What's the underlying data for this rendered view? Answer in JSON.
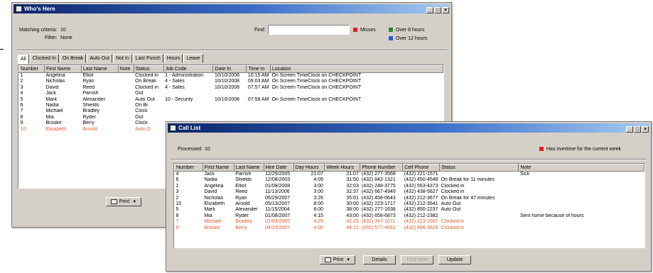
{
  "back_window": {
    "title": "Who's Here",
    "matching_label": "Matching criteria:",
    "matching_value": "10",
    "filter_label": "Filter:",
    "filter_value": "None",
    "find_label": "Find:",
    "find_value": "",
    "legend": [
      {
        "label": "Misses",
        "color": "#e0201e"
      },
      {
        "label": "Over 8 hours",
        "color": "#2a8a2a"
      },
      {
        "label": "Over 12 hours",
        "color": "#2d5bd0"
      }
    ],
    "tabs": [
      "All",
      "Clocked In",
      "On Break",
      "Auto Out",
      "Not In",
      "Last Punch",
      "Hours",
      "Leave"
    ],
    "columns": [
      "Number",
      "First Name",
      "Last Name",
      "Note",
      "Status",
      "Job Code",
      "Date In",
      "Time In",
      "Location"
    ],
    "rows": [
      [
        "1",
        "Angelina",
        "Elliot",
        "",
        "Clocked in",
        "1 - Administration",
        "10/10/2008",
        "10:15 AM",
        "On Screen TimeClock on CHECKPOINT",
        ""
      ],
      [
        "2",
        "Nicholas",
        "Ryan",
        "",
        "On Break",
        "4 - Sales",
        "10/10/2008",
        "09:03 AM",
        "On Screen TimeClock on CHECKPOINT",
        ""
      ],
      [
        "3",
        "David",
        "Reed",
        "",
        "Clocked in",
        "4 - Sales",
        "10/10/2008",
        "07:57 AM",
        "On Screen TimeClock on CHECKPOINT",
        ""
      ],
      [
        "4",
        "Jack",
        "Parrish",
        "",
        "Out",
        "",
        "",
        "",
        "",
        ""
      ],
      [
        "5",
        "Mark",
        "Alexander",
        "",
        "Auto Out",
        "10 - Security",
        "10/10/2008",
        "07:58 AM",
        "On Screen TimeClock on CHECKPOINT",
        ""
      ],
      [
        "6",
        "Nadia",
        "Shields",
        "",
        "On Br",
        "",
        "",
        "",
        "",
        ""
      ],
      [
        "7",
        "Michael",
        "Bradley",
        "",
        "Clock",
        "",
        "",
        "",
        "",
        ""
      ],
      [
        "8",
        "Mia",
        "Ryder",
        "",
        "Out",
        "",
        "",
        "",
        "",
        ""
      ],
      [
        "9",
        "Brooke",
        "Berry",
        "",
        "Clock",
        "",
        "",
        "",
        "",
        ""
      ],
      [
        "10",
        "Elizabeth",
        "Arnold",
        "",
        "Auto O",
        "",
        "",
        "",
        "",
        "hl"
      ]
    ],
    "print_label": "Print"
  },
  "front_window": {
    "title": "Call List",
    "processed_label": "Processed:",
    "processed_value": "10",
    "legend_label": "Has overtime for the current week",
    "legend_color": "#e0201e",
    "columns": [
      "Number",
      "First Name",
      "Last Name",
      "Hire Date",
      "Day Hours",
      "Week Hours",
      "Phone Number",
      "Cell Phone",
      "Status",
      "Note"
    ],
    "rows": [
      [
        "4",
        "Jack",
        "Parrish",
        "12/29/2005",
        "21:07",
        "21:07",
        "(432) 277-3568",
        "(432) 221-1571",
        "",
        "Sick",
        ""
      ],
      [
        "6",
        "Nadia",
        "Shields",
        "12/08/2003",
        "4:09",
        "31:50",
        "(432) 842-1321",
        "(432) 450-4548",
        "On Break for 11 minutes",
        "",
        ""
      ],
      [
        "1",
        "Angelina",
        "Elliot",
        "01/08/2008",
        "3:00",
        "32:03",
        "(432) 248-3775",
        "(432) 553-4373",
        "Clocked in",
        "",
        ""
      ],
      [
        "3",
        "David",
        "Reed",
        "11/13/2006",
        "3:00",
        "32:37",
        "(432) 667-4949",
        "(432) 438-5627",
        "Clocked in",
        "",
        ""
      ],
      [
        "2",
        "Nicholas",
        "Ryan",
        "05/29/2007",
        "3:26",
        "35:01",
        "(432) 458-0643",
        "(432) 212-3677",
        "On Break for 47 minutes",
        "",
        ""
      ],
      [
        "10",
        "Elizabeth",
        "Arnold",
        "05/13/2007",
        "8:00",
        "30:00",
        "(432) 223-1717",
        "(432) 212-3541",
        "Auto Out",
        "",
        ""
      ],
      [
        "5",
        "Mark",
        "Alexander",
        "11/15/2004",
        "8:00",
        "38:00",
        "(432) 277-1638",
        "(432) 850-2237",
        "Auto Out",
        "",
        ""
      ],
      [
        "8",
        "Mia",
        "Ryder",
        "01/08/2007",
        "4:15",
        "43:00",
        "(432) 658-6873",
        "(432) 212-2382",
        "",
        "Sent home because of hours",
        ""
      ],
      [
        "7",
        "Michael",
        "Bradley",
        "07/03/2005",
        "4:25",
        "42:25",
        "(432) 347-1011",
        "(432) 223-1567",
        "Clocked in",
        "",
        "hl"
      ],
      [
        "9",
        "Brooke",
        "Berry",
        "04/23/2007",
        "4:00",
        "44:12",
        "(432) 577-4061",
        "(432) 898-3628",
        "Clocked in",
        "",
        "hl"
      ]
    ],
    "buttons": {
      "print": "Print",
      "details": "Details",
      "find_now": "Find Now",
      "update": "Update"
    }
  }
}
